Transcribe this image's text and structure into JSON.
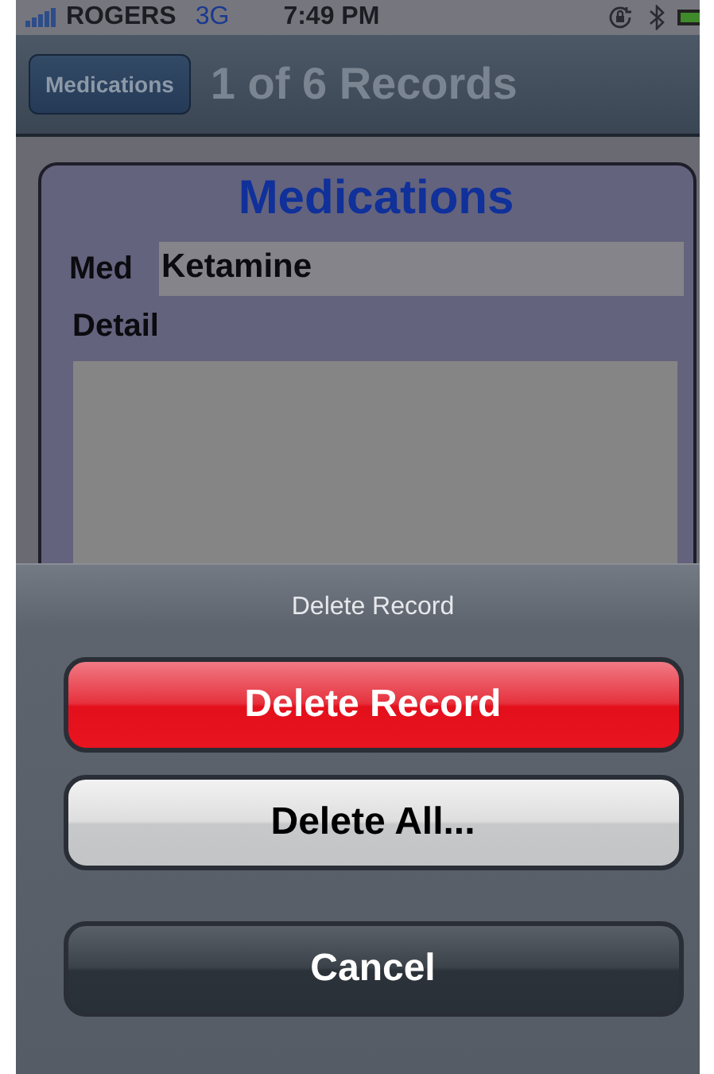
{
  "status_bar": {
    "carrier": "ROGERS",
    "network": "3G",
    "time": "7:49 PM"
  },
  "nav_bar": {
    "back_button": "Medications",
    "title": "1 of 6 Records"
  },
  "form": {
    "title": "Medications",
    "fields": [
      {
        "label": "Med",
        "value": "Ketamine"
      },
      {
        "label": "Detail"
      }
    ]
  },
  "action_sheet": {
    "title": "Delete Record",
    "buttons": [
      {
        "label": "Delete Record",
        "kind": "destructive"
      },
      {
        "label": "Delete All...",
        "kind": "default"
      },
      {
        "label": "Cancel",
        "kind": "cancel"
      }
    ]
  }
}
